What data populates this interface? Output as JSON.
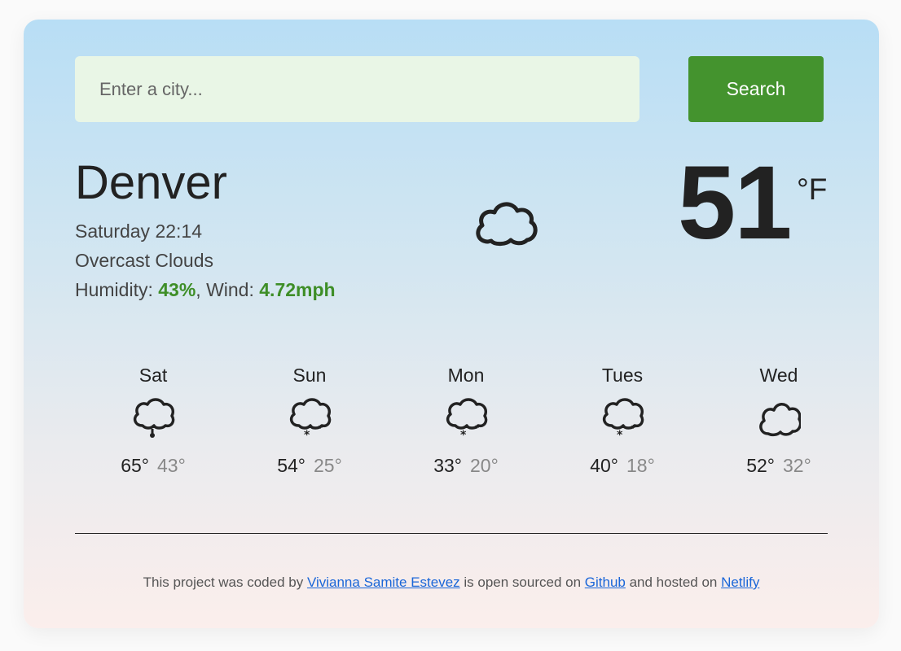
{
  "search": {
    "placeholder": "Enter a city...",
    "button_label": "Search"
  },
  "current": {
    "city": "Denver",
    "datetime": "Saturday 22:14",
    "description": "Overcast Clouds",
    "humidity_label": "Humidity: ",
    "humidity_value": "43%",
    "wind_label": ", Wind: ",
    "wind_value": "4.72mph",
    "temperature": "51",
    "unit": "°F",
    "icon": "cloud-icon"
  },
  "forecast": [
    {
      "day": "Sat",
      "max": "65°",
      "min": "43°",
      "icon": "rain-icon"
    },
    {
      "day": "Sun",
      "max": "54°",
      "min": "25°",
      "icon": "snow-icon"
    },
    {
      "day": "Mon",
      "max": "33°",
      "min": "20°",
      "icon": "snow-icon"
    },
    {
      "day": "Tues",
      "max": "40°",
      "min": "18°",
      "icon": "snow-icon"
    },
    {
      "day": "Wed",
      "max": "52°",
      "min": "32°",
      "icon": "cloud-icon"
    }
  ],
  "footer": {
    "text1": "This project was coded by ",
    "author_link": "Vivianna Samite Estevez",
    "text2": " is open sourced on ",
    "github_link": "Github",
    "text3": " and hosted on ",
    "netlify_link": "Netlify"
  },
  "colors": {
    "accent": "#44932e",
    "highlight": "#3e8e27",
    "input_bg": "#e9f6e6",
    "link": "#1a66d8"
  }
}
